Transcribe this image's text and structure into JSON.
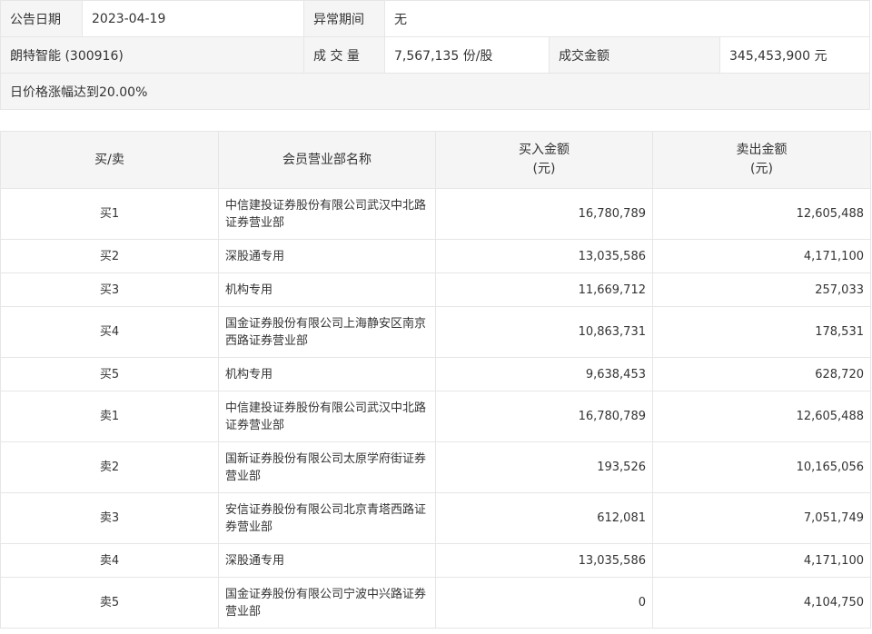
{
  "summary": {
    "date_label": "公告日期",
    "date_value": "2023-04-19",
    "period_label": "异常期间",
    "period_value": "无",
    "stock_name": "朗特智能 (300916)",
    "volume_label": "成 交 量",
    "volume_value": "7,567,135 份/股",
    "amount_label": "成交金额",
    "amount_value": "345,453,900 元",
    "reason": "日价格涨幅达到20.00%"
  },
  "table": {
    "headers": {
      "side": "买/卖",
      "name": "会员营业部名称",
      "buy_line1": "买入金额",
      "buy_line2": "(元)",
      "sell_line1": "卖出金额",
      "sell_line2": "(元)"
    },
    "rows": [
      {
        "side": "买1",
        "name": "中信建投证券股份有限公司武汉中北路证券营业部",
        "buy": "16,780,789",
        "sell": "12,605,488"
      },
      {
        "side": "买2",
        "name": "深股通专用",
        "buy": "13,035,586",
        "sell": "4,171,100"
      },
      {
        "side": "买3",
        "name": "机构专用",
        "buy": "11,669,712",
        "sell": "257,033"
      },
      {
        "side": "买4",
        "name": "国金证券股份有限公司上海静安区南京西路证券营业部",
        "buy": "10,863,731",
        "sell": "178,531"
      },
      {
        "side": "买5",
        "name": "机构专用",
        "buy": "9,638,453",
        "sell": "628,720"
      },
      {
        "side": "卖1",
        "name": "中信建投证券股份有限公司武汉中北路证券营业部",
        "buy": "16,780,789",
        "sell": "12,605,488"
      },
      {
        "side": "卖2",
        "name": "国新证券股份有限公司太原学府街证券营业部",
        "buy": "193,526",
        "sell": "10,165,056"
      },
      {
        "side": "卖3",
        "name": "安信证券股份有限公司北京青塔西路证券营业部",
        "buy": "612,081",
        "sell": "7,051,749"
      },
      {
        "side": "卖4",
        "name": "深股通专用",
        "buy": "13,035,586",
        "sell": "4,171,100"
      },
      {
        "side": "卖5",
        "name": "国金证券股份有限公司宁波中兴路证券营业部",
        "buy": "0",
        "sell": "4,104,750"
      }
    ]
  }
}
